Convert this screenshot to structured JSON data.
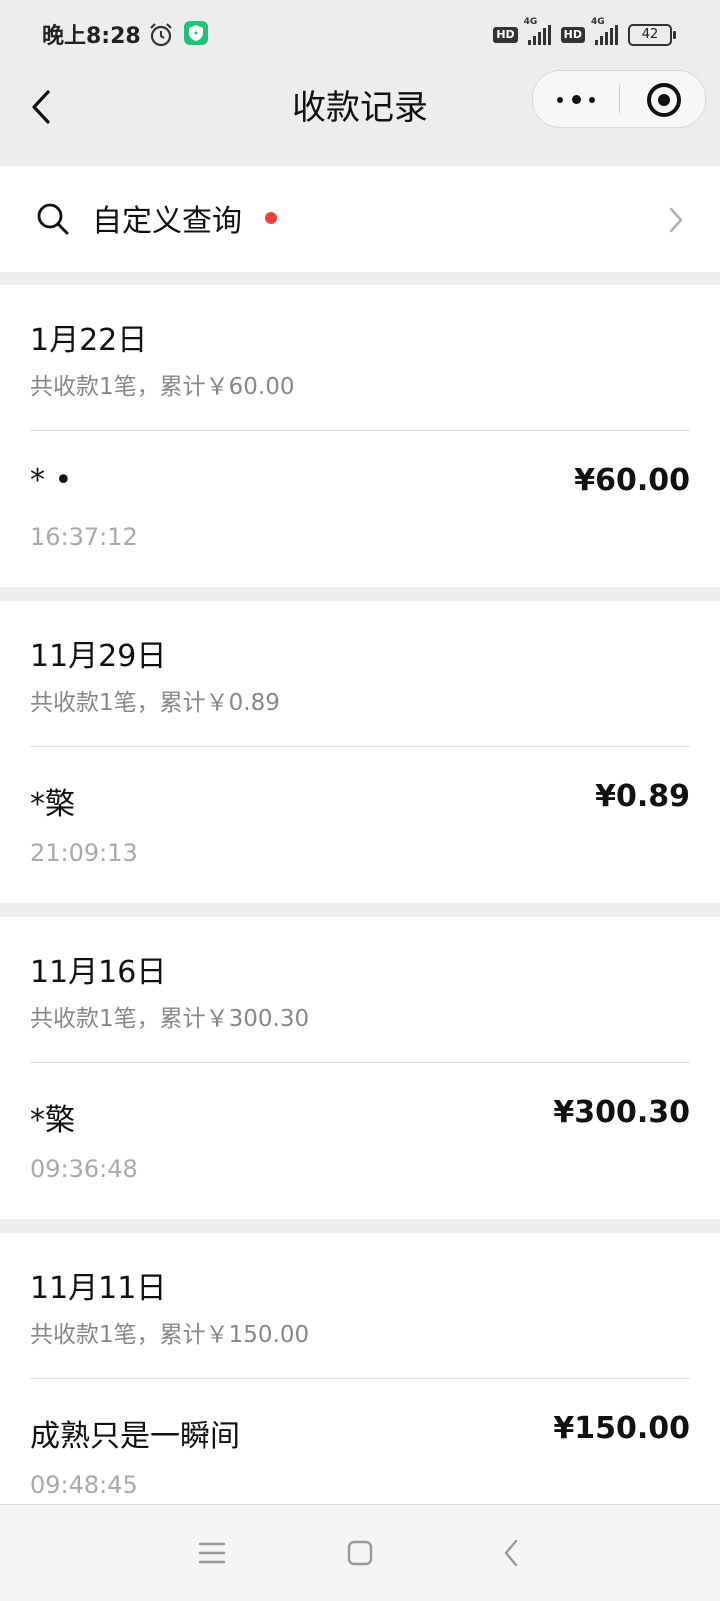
{
  "status_bar": {
    "time": "晚上8:28",
    "hd1": "HD",
    "hd2": "HD",
    "net1": "4G",
    "net2": "4G",
    "battery": "42"
  },
  "nav": {
    "title": "收款记录"
  },
  "search": {
    "label": "自定义查询"
  },
  "groups": [
    {
      "date": "1月22日",
      "summary": "共收款1笔，累计￥60.00",
      "record": {
        "name": "* •",
        "amount": "¥60.00",
        "time": "16:37:12"
      }
    },
    {
      "date": "11月29日",
      "summary": "共收款1笔，累计￥0.89",
      "record": {
        "name": "*檠",
        "amount": "¥0.89",
        "time": "21:09:13"
      }
    },
    {
      "date": "11月16日",
      "summary": "共收款1笔，累计￥300.30",
      "record": {
        "name": "*檠",
        "amount": "¥300.30",
        "time": "09:36:48"
      }
    },
    {
      "date": "11月11日",
      "summary": "共收款1笔，累计￥150.00",
      "record": {
        "name": "成熟只是一瞬间",
        "amount": "¥150.00",
        "time": "09:48:45"
      }
    }
  ],
  "colors": {
    "background": "#ededed",
    "card": "#ffffff",
    "secondary_text": "#888888",
    "notification_dot": "#f04040",
    "shield_badge": "#22c27a"
  }
}
